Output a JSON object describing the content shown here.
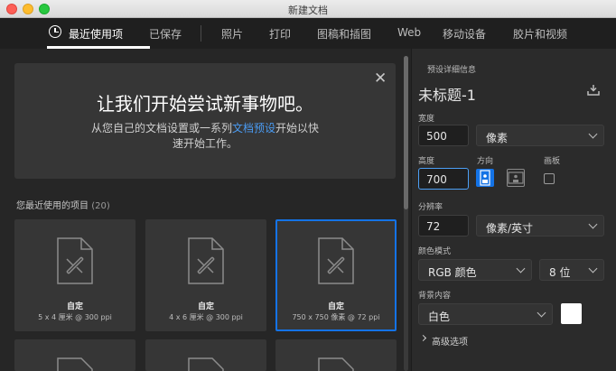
{
  "window": {
    "title": "新建文档"
  },
  "tabs": [
    {
      "label": "最近使用项",
      "active": true
    },
    {
      "label": "已保存"
    },
    {
      "label": "照片"
    },
    {
      "label": "打印"
    },
    {
      "label": "图稿和插图"
    },
    {
      "label": "Web"
    },
    {
      "label": "移动设备"
    },
    {
      "label": "胶片和视频"
    }
  ],
  "hero": {
    "title": "让我们开始尝试新事物吧。",
    "sub_before": "从您自己的文档设置或一系列",
    "sub_link": "文档预设",
    "sub_after": "开始以快速开始工作。"
  },
  "recent": {
    "heading": "您最近使用的项目",
    "count": "(20)",
    "items": [
      {
        "title": "自定",
        "subtitle": "5 x 4 厘米 @ 300 ppi"
      },
      {
        "title": "自定",
        "subtitle": "4 x 6 厘米 @ 300 ppi"
      },
      {
        "title": "自定",
        "subtitle": "750 x 750 像素 @ 72 ppi",
        "selected": true
      }
    ]
  },
  "details": {
    "section_label": "预设详细信息",
    "name": "未标题-1",
    "width_label": "宽度",
    "width_value": "500",
    "width_unit": "像素",
    "height_label": "高度",
    "height_value": "700",
    "orientation_label": "方向",
    "artboard_label": "画板",
    "resolution_label": "分辨率",
    "resolution_value": "72",
    "resolution_unit": "像素/英寸",
    "color_mode_label": "颜色模式",
    "color_mode": "RGB 颜色",
    "bit_depth": "8 位",
    "background_label": "背景内容",
    "background": "白色",
    "advanced_label": "高级选项"
  },
  "colors": {
    "accent": "#1473e6",
    "link": "#4a9bf2",
    "bg": "#262626"
  }
}
